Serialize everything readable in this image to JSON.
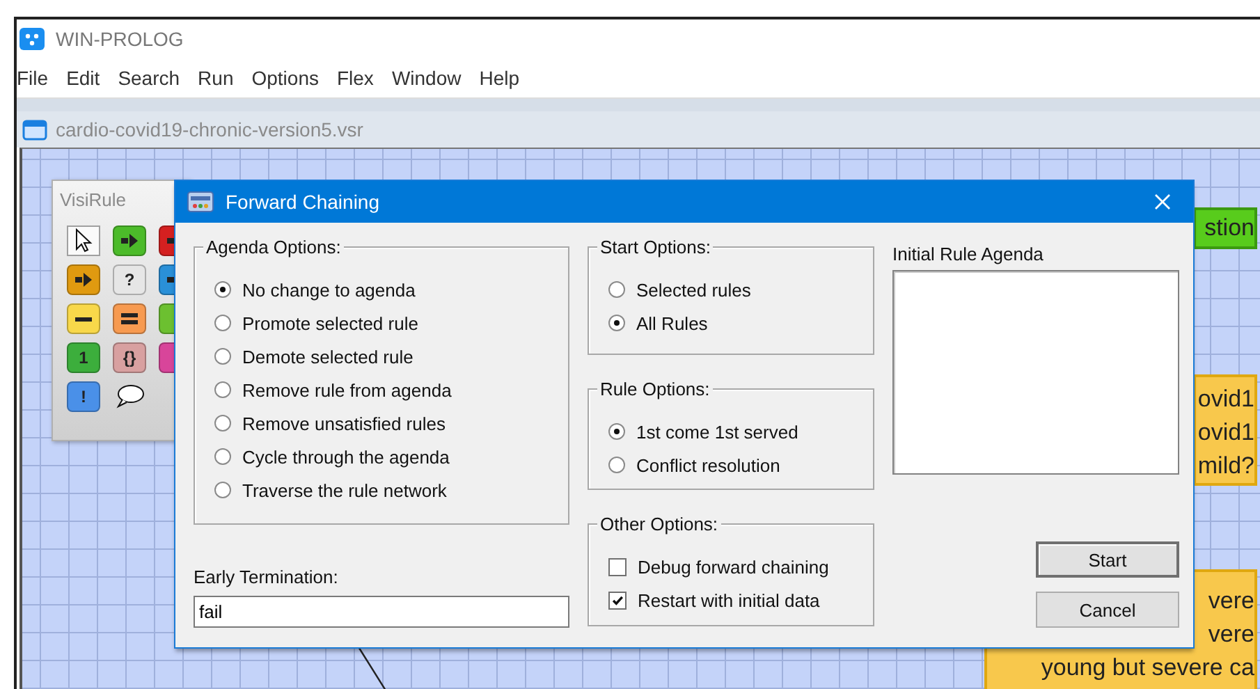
{
  "app": {
    "title": "WIN-PROLOG",
    "menu": [
      "File",
      "Edit",
      "Search",
      "Run",
      "Options",
      "Flex",
      "Window",
      "Help"
    ]
  },
  "document": {
    "title": "cardio-covid19-chronic-version5.vsr"
  },
  "palette": {
    "title": "VisiRule",
    "tools": [
      {
        "kind": "pointer",
        "selected": true
      },
      {
        "kind": "arrow",
        "color": "#4cbb2a",
        "selected": false
      },
      {
        "kind": "arrow",
        "color": "#d42020",
        "selected": false
      },
      {
        "kind": "arrow",
        "color": "#e09a10",
        "selected": false
      },
      {
        "kind": "glyph",
        "color": "#e6e6e6",
        "glyph": "?",
        "selected": false
      },
      {
        "kind": "arrow",
        "color": "#2a90d8",
        "selected": false
      },
      {
        "kind": "dash",
        "color": "#f8d84a",
        "selected": false
      },
      {
        "kind": "double-dash",
        "color": "#f79a50",
        "selected": false
      },
      {
        "kind": "tile",
        "color": "#6cc030",
        "selected": false
      },
      {
        "kind": "glyph",
        "color": "#3cae3c",
        "glyph": "1",
        "selected": false
      },
      {
        "kind": "glyph",
        "color": "#d8a0a0",
        "glyph": "{}",
        "selected": false
      },
      {
        "kind": "tile",
        "color": "#d8459a",
        "selected": false
      },
      {
        "kind": "glyph",
        "color": "#4a90e8",
        "glyph": "!",
        "selected": false
      },
      {
        "kind": "bubble",
        "selected": false
      }
    ]
  },
  "canvas_nodes": [
    {
      "kind": "question",
      "lines": [
        "stion"
      ]
    },
    {
      "kind": "statement",
      "lines": [
        "ovid1",
        "ovid1",
        "mild?"
      ]
    },
    {
      "kind": "statement",
      "lines": [
        "vere",
        "vere",
        "young but severe ca"
      ]
    }
  ],
  "dialog": {
    "title": "Forward Chaining",
    "agenda_options": {
      "label": "Agenda Options:",
      "options": [
        {
          "label": "No change to agenda",
          "selected": true
        },
        {
          "label": "Promote selected rule",
          "selected": false
        },
        {
          "label": "Demote selected rule",
          "selected": false
        },
        {
          "label": "Remove rule from agenda",
          "selected": false
        },
        {
          "label": "Remove unsatisfied rules",
          "selected": false
        },
        {
          "label": "Cycle through the agenda",
          "selected": false
        },
        {
          "label": "Traverse the rule network",
          "selected": false
        }
      ]
    },
    "early_termination": {
      "label": "Early Termination:",
      "value": "fail"
    },
    "start_options": {
      "label": "Start Options:",
      "options": [
        {
          "label": "Selected rules",
          "selected": false
        },
        {
          "label": "All Rules",
          "selected": true
        }
      ]
    },
    "rule_options": {
      "label": "Rule Options:",
      "options": [
        {
          "label": "1st come 1st served",
          "selected": true
        },
        {
          "label": "Conflict resolution",
          "selected": false
        }
      ]
    },
    "other_options": {
      "label": "Other Options:",
      "items": [
        {
          "label": "Debug forward chaining",
          "checked": false
        },
        {
          "label": "Restart with initial data",
          "checked": true
        }
      ]
    },
    "initial_agenda": {
      "label": "Initial Rule Agenda"
    },
    "buttons": [
      {
        "label": "Start",
        "default": true
      },
      {
        "label": "Cancel",
        "default": false
      }
    ]
  }
}
